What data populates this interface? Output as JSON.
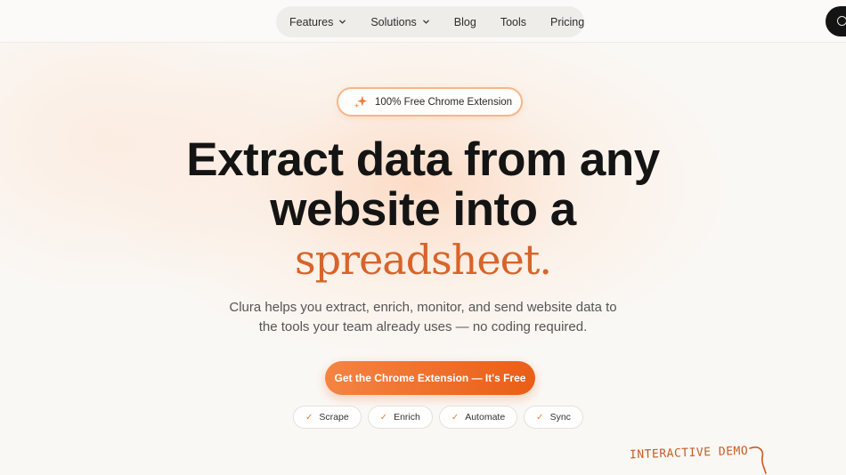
{
  "nav": {
    "items": [
      {
        "label": "Features",
        "has_dropdown": true
      },
      {
        "label": "Solutions",
        "has_dropdown": true
      },
      {
        "label": "Blog",
        "has_dropdown": false
      },
      {
        "label": "Tools",
        "has_dropdown": false
      },
      {
        "label": "Pricing",
        "has_dropdown": false
      }
    ]
  },
  "badge": {
    "label": "100% Free Chrome Extension",
    "icon": "sparkle-icon"
  },
  "hero": {
    "line1": "Extract data from any",
    "line2": "website into a",
    "line3": "spreadsheet.",
    "sub1": "Clura helps you extract, enrich, monitor, and send website data to",
    "sub2": "the tools your team already uses — no coding required."
  },
  "cta": {
    "label": "Get the Chrome Extension — It's Free"
  },
  "chips": [
    {
      "label": "Scrape"
    },
    {
      "label": "Enrich"
    },
    {
      "label": "Automate"
    },
    {
      "label": "Sync"
    }
  ],
  "demo": {
    "label": "INTERACTIVE DEMO"
  },
  "colors": {
    "accent": "#ea5e17",
    "accent_light": "#f48443",
    "text": "#141414",
    "background": "#faf8f5"
  }
}
